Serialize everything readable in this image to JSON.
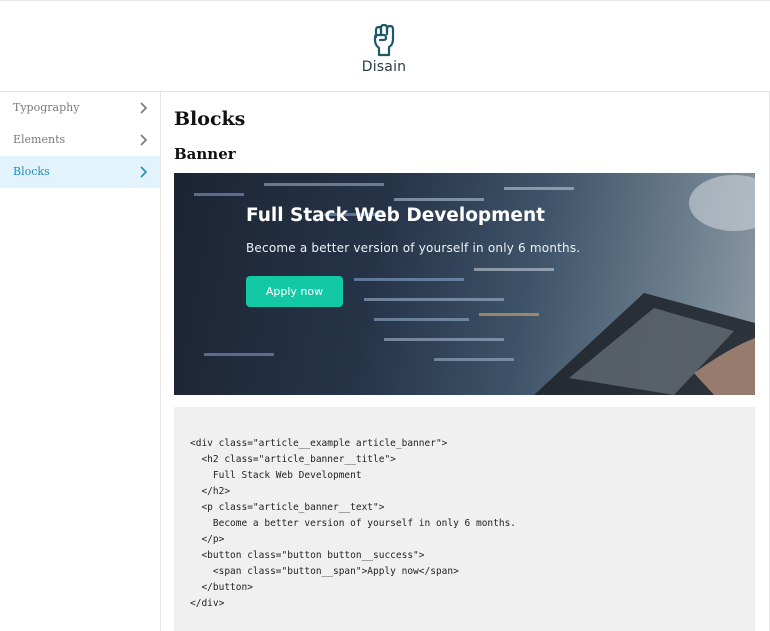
{
  "header": {
    "logo_text": "Disain",
    "logo_icon": "raised-fist-icon"
  },
  "sidebar": {
    "items": [
      {
        "label": "Typography",
        "active": false,
        "icon": "chevron-right-icon"
      },
      {
        "label": "Elements",
        "active": false,
        "icon": "chevron-right-icon"
      },
      {
        "label": "Blocks",
        "active": true,
        "icon": "chevron-right-icon"
      }
    ]
  },
  "main": {
    "page_title": "Blocks",
    "section_title": "Banner",
    "banner": {
      "title": "Full Stack Web Development",
      "text": "Become a better version of yourself in only 6 months.",
      "button_label": "Apply now",
      "button_color": "#13c9a5"
    },
    "code_lines": [
      "<div class=\"article__example article_banner\">",
      "  <h2 class=\"article_banner__title\">",
      "    Full Stack Web Development",
      "  </h2>",
      "  <p class=\"article_banner__text\">",
      "    Become a better version of yourself in only 6 months.",
      "  </p>",
      "  <button class=\"button button__success\">",
      "    <span class=\"button__span\">Apply now</span>",
      "  </button>",
      "</div>"
    ]
  },
  "colors": {
    "accent": "#1b8fbf",
    "active_bg": "#e3f3fb",
    "success": "#13c9a5"
  }
}
